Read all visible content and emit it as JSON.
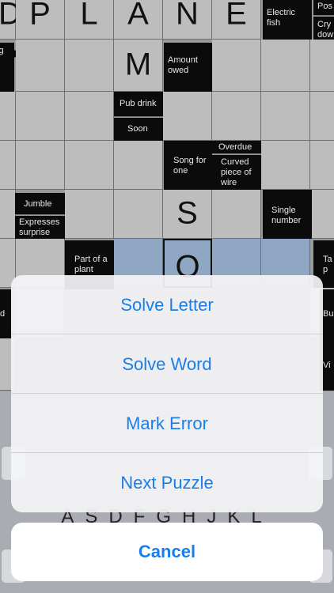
{
  "puzzle": {
    "top_letters": [
      "D",
      "P",
      "L",
      "A",
      "N",
      "E"
    ],
    "letter_m": "M",
    "letter_s": "S",
    "letter_o": "O",
    "clues": {
      "electric_fish": "Electric fish",
      "pos_partial": "Pos",
      "cry_partial": "Cry dow",
      "ing_partial": "ing a-",
      "amount_owed": "Amount owed",
      "pub_drink": "Pub drink",
      "soon": "Soon",
      "overdue": "Overdue",
      "song_for_one": "Song for one",
      "curved_wire": "Curved piece of wire",
      "jumble": "Jumble",
      "expresses_surprise": "Expresses surprise",
      "single_number": "Single number",
      "part_of_plant": "Part of a plant",
      "ta_partial": "Ta a p",
      "d_partial": "d",
      "bu_partial": "Bu",
      "vi_partial": "Vi"
    }
  },
  "keyboard": {
    "letters_row": "ASDFGHJKL"
  },
  "action_sheet": {
    "solve_letter": "Solve Letter",
    "solve_word": "Solve Word",
    "mark_error": "Mark Error",
    "next_puzzle": "Next Puzzle",
    "cancel": "Cancel"
  },
  "colors": {
    "accent": "#1a7ee6",
    "clue_bg": "#0b0b0b",
    "cell_bg": "#bdbdbd",
    "selected_cell": "#8fa7c2"
  }
}
